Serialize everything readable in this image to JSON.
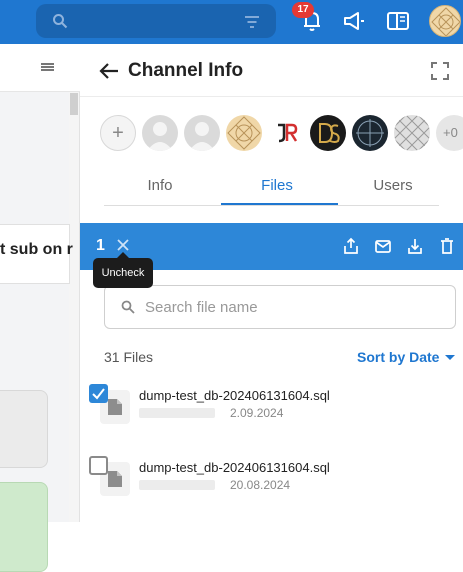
{
  "topbar": {
    "notification_count": "17",
    "accent": "#1f77d0"
  },
  "left_panel": {
    "message_snippet": "t sub on r"
  },
  "panel": {
    "title": "Channel Info",
    "more_members_label": "+0",
    "tabs": [
      {
        "label": "Info",
        "active": false
      },
      {
        "label": "Files",
        "active": true
      },
      {
        "label": "Users",
        "active": false
      }
    ]
  },
  "selection": {
    "count": "1",
    "tooltip": "Uncheck"
  },
  "files": {
    "search_placeholder": "Search file name",
    "count_label": "31 Files",
    "sort_label": "Sort by Date",
    "items": [
      {
        "name": "dump-test_db-202406131604.sql",
        "date": "2.09.2024",
        "checked": true
      },
      {
        "name": "dump-test_db-202406131604.sql",
        "date": "20.08.2024",
        "checked": false
      }
    ]
  },
  "icons": {
    "search": "search-icon",
    "filter": "filter-icon",
    "bell": "bell-icon",
    "announce": "megaphone-icon",
    "sidebar": "sidebar-icon"
  }
}
